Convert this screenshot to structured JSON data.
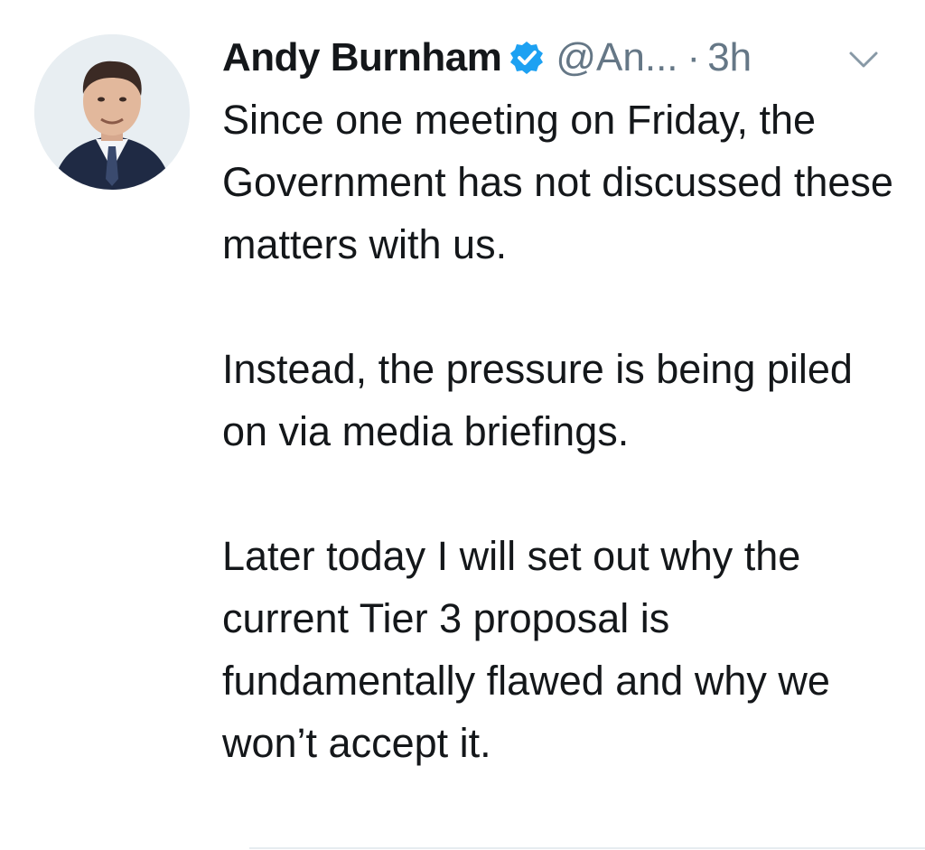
{
  "tweet": {
    "author": {
      "display_name": "Andy Burnham",
      "handle": "@An...",
      "verified": true,
      "avatar_icon": "profile-photo"
    },
    "separator": "·",
    "time": "3h",
    "menu_icon": "chevron-down-icon",
    "paragraphs": [
      "Since one meeting on Friday, the Government has not discussed these matters with us.",
      "Instead, the pressure is being piled on via media briefings.",
      "Later today I will set out why the current Tier 3 proposal is fundamentally flawed and why we won’t accept it."
    ]
  },
  "colors": {
    "text": "#14171a",
    "secondary": "#657786",
    "verified_badge": "#1da1f2",
    "divider": "#e6ecf0"
  }
}
